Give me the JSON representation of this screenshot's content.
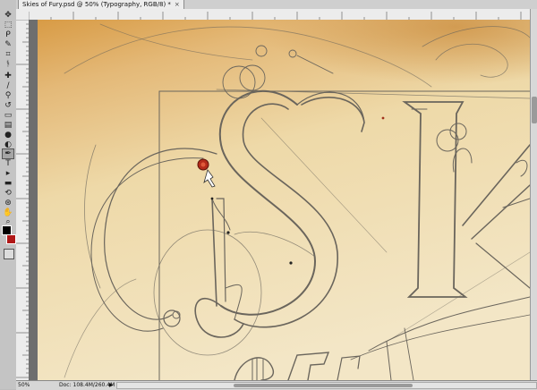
{
  "document": {
    "tab_title": "Skies of Fury.psd @ 50% (Typography, RGB/8) *",
    "close_glyph": "×"
  },
  "tools": [
    {
      "icon": "move-icon",
      "glyph": "✥"
    },
    {
      "icon": "marquee-icon",
      "glyph": "⬚"
    },
    {
      "icon": "lasso-icon",
      "glyph": "ᑭ"
    },
    {
      "icon": "quick-select-icon",
      "glyph": "✎"
    },
    {
      "icon": "crop-icon",
      "glyph": "⌗"
    },
    {
      "icon": "eyedropper-icon",
      "glyph": "ᚬ"
    },
    {
      "icon": "healing-brush-icon",
      "glyph": "✚"
    },
    {
      "icon": "brush-icon",
      "glyph": "∕"
    },
    {
      "icon": "clone-stamp-icon",
      "glyph": "⚲"
    },
    {
      "icon": "history-brush-icon",
      "glyph": "↺"
    },
    {
      "icon": "eraser-icon",
      "glyph": "▭"
    },
    {
      "icon": "gradient-icon",
      "glyph": "▤"
    },
    {
      "icon": "blur-icon",
      "glyph": "●"
    },
    {
      "icon": "dodge-icon",
      "glyph": "◐"
    },
    {
      "icon": "pen-icon",
      "glyph": "✒"
    },
    {
      "icon": "type-icon",
      "glyph": "T"
    },
    {
      "icon": "path-select-icon",
      "glyph": "▸"
    },
    {
      "icon": "shape-icon",
      "glyph": "▬"
    },
    {
      "icon": "3d-rotate-icon",
      "glyph": "⟲"
    },
    {
      "icon": "3d-orbit-icon",
      "glyph": "⊛"
    },
    {
      "icon": "hand-icon",
      "glyph": "✋"
    },
    {
      "icon": "zoom-icon",
      "glyph": "⌕"
    }
  ],
  "colors": {
    "foreground": "#000000",
    "background": "#b01818",
    "parchment_light": "#f2e7c8",
    "parchment_dark": "#d9a153",
    "sketch_line": "#5e5a52"
  },
  "status": {
    "zoom": "50%",
    "doc_size": "Doc: 108.4M/260.4M",
    "arrow": "▶"
  }
}
